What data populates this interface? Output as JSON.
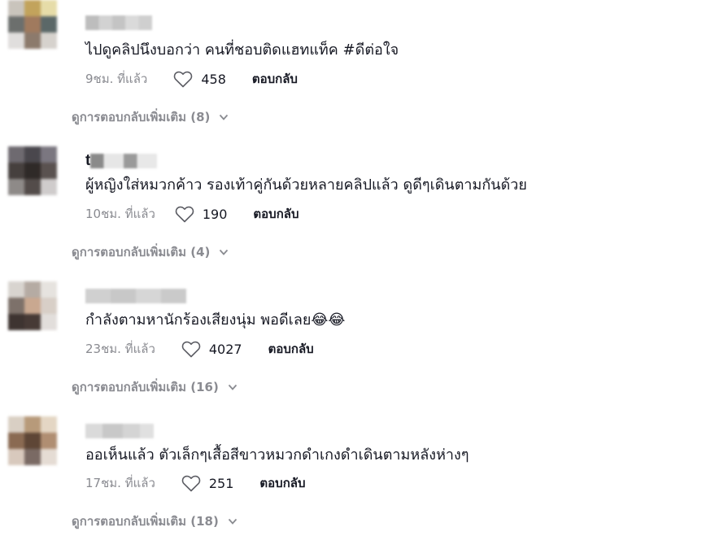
{
  "comments": [
    {
      "username": "",
      "text": "ไปดูคลิปนึงบอกว่า คนที่ชอบติดแฮทแท็ค #ดีต่อใจ",
      "time": "9ชม. ที่แล้ว",
      "likes": "458",
      "reply_label": "ตอบกลับ",
      "more_replies": "ดูการตอบกลับเพิ่มเติม (8)"
    },
    {
      "username": "t",
      "text": "ผู้หญิงใส่หมวกค้าว รองเท้าคู่กันด้วยหลายคลิปแล้ว ดูดีๆเดินตามกันด้วย",
      "time": "10ชม. ที่แล้ว",
      "likes": "190",
      "reply_label": "ตอบกลับ",
      "more_replies": "ดูการตอบกลับเพิ่มเติม (4)"
    },
    {
      "username": "",
      "text": "กำลังตามหานักร้องเสียงนุ่ม พอดีเลย😂😂",
      "time": "23ชม. ที่แล้ว",
      "likes": "4027",
      "reply_label": "ตอบกลับ",
      "more_replies": "ดูการตอบกลับเพิ่มเติม (16)"
    },
    {
      "username": "",
      "text": "ออเห็นแล้ว ตัวเล็กๆเสื้อสีขาวหมวกดำเกงดำเดินตามหลังห่างๆ",
      "time": "17ชม. ที่แล้ว",
      "likes": "251",
      "reply_label": "ตอบกลับ",
      "more_replies": "ดูการตอบกลับเพิ่มเติม (18)"
    }
  ],
  "icons": {
    "like": "heart-outline-icon",
    "expand": "chevron-down-icon"
  },
  "colors": {
    "text": "#161823",
    "muted": "#8a8b91"
  }
}
